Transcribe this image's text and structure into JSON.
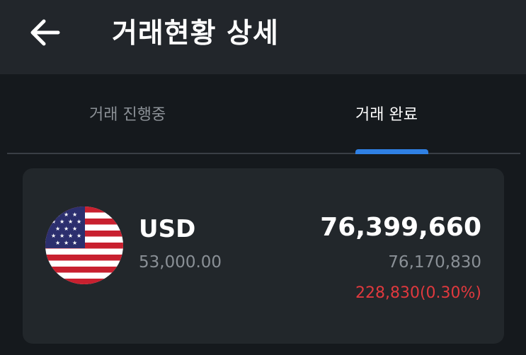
{
  "header": {
    "title": "거래현황 상세",
    "back_icon": "arrow-left-icon"
  },
  "tabs": [
    {
      "label": "거래 진행중",
      "active": false
    },
    {
      "label": "거래 완료",
      "active": true
    }
  ],
  "colors": {
    "accent": "#2f80e4",
    "negative": "#e0393e",
    "background": "#15191d",
    "card": "#22272b"
  },
  "transaction": {
    "flag_icon": "us-flag-icon",
    "currency": "USD",
    "foreign_amount": "53,000.00",
    "krw_total": "76,399,660",
    "krw_base": "76,170,830",
    "difference": "228,830(0.30%)"
  }
}
